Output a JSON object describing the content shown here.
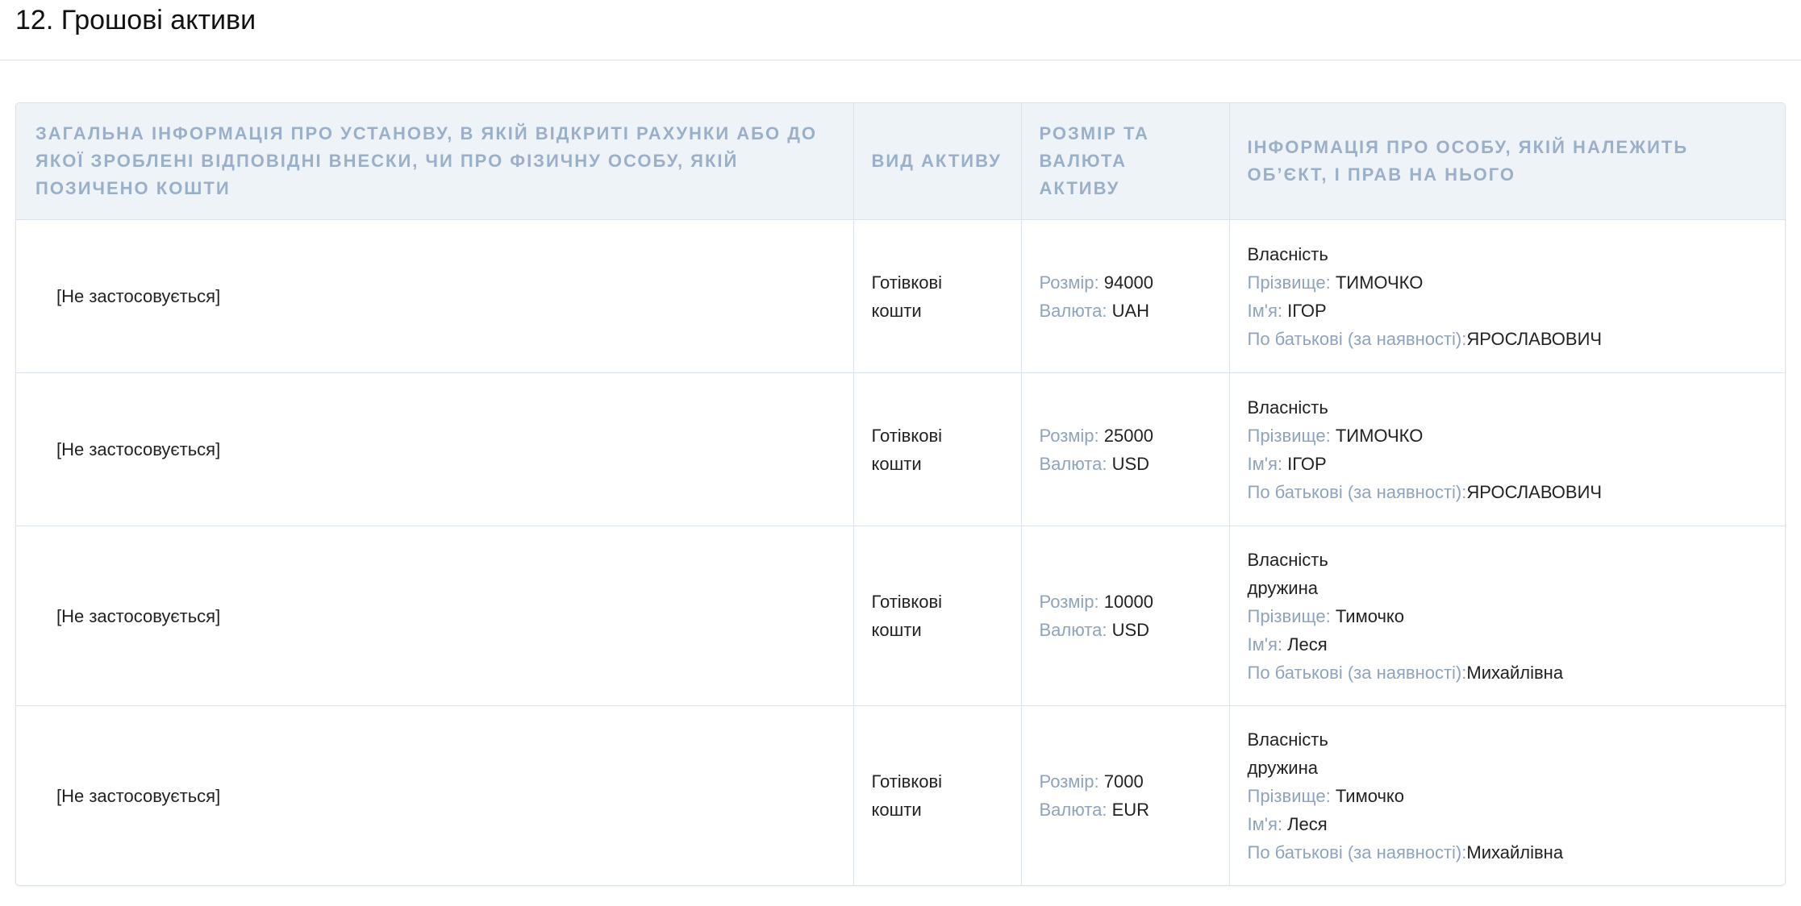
{
  "section": {
    "title": "12. Грошові активи"
  },
  "table": {
    "headers": {
      "institution": "Загальна інформація про установу, в якій відкриті рахунки або до якої зроблені відповідні внески, чи про фізичну особу, якій позичено кошти",
      "asset_type": "Вид активу",
      "amount_currency": "Розмір та валюта активу",
      "owner_info": "Інформація про особу, якій належить об’єкт, і прав на нього"
    },
    "rows": [
      {
        "institution": "[Не застосовується]",
        "asset_type_l1": "Готівкові",
        "asset_type_l2": "кошти",
        "amount_label": "Розмір: ",
        "amount": "94000",
        "currency_label": "Валюта: ",
        "currency": "UAH",
        "right": "Власність",
        "relation": "",
        "surname_label": "Прізвище: ",
        "surname": "ТИМОЧКО",
        "name_label": "Ім'я: ",
        "name": "ІГОР",
        "patronymic_label": "По батькові (за наявності):",
        "patronymic": "ЯРОСЛАВОВИЧ"
      },
      {
        "institution": "[Не застосовується]",
        "asset_type_l1": "Готівкові",
        "asset_type_l2": "кошти",
        "amount_label": "Розмір: ",
        "amount": "25000",
        "currency_label": "Валюта: ",
        "currency": "USD",
        "right": "Власність",
        "relation": "",
        "surname_label": "Прізвище: ",
        "surname": "ТИМОЧКО",
        "name_label": "Ім'я: ",
        "name": "ІГОР",
        "patronymic_label": "По батькові (за наявності):",
        "patronymic": "ЯРОСЛАВОВИЧ"
      },
      {
        "institution": "[Не застосовується]",
        "asset_type_l1": "Готівкові",
        "asset_type_l2": "кошти",
        "amount_label": "Розмір: ",
        "amount": "10000",
        "currency_label": "Валюта: ",
        "currency": "USD",
        "right": "Власність",
        "relation": "дружина",
        "surname_label": "Прізвище: ",
        "surname": "Тимочко",
        "name_label": "Ім'я: ",
        "name": "Леся",
        "patronymic_label": "По батькові (за наявності):",
        "patronymic": "Михайлівна"
      },
      {
        "institution": "[Не застосовується]",
        "asset_type_l1": "Готівкові",
        "asset_type_l2": "кошти",
        "amount_label": "Розмір: ",
        "amount": "7000",
        "currency_label": "Валюта: ",
        "currency": "EUR",
        "right": "Власність",
        "relation": "дружина",
        "surname_label": "Прізвище: ",
        "surname": "Тимочко",
        "name_label": "Ім'я: ",
        "name": "Леся",
        "patronymic_label": "По батькові (за наявності):",
        "patronymic": "Михайлівна"
      }
    ]
  }
}
